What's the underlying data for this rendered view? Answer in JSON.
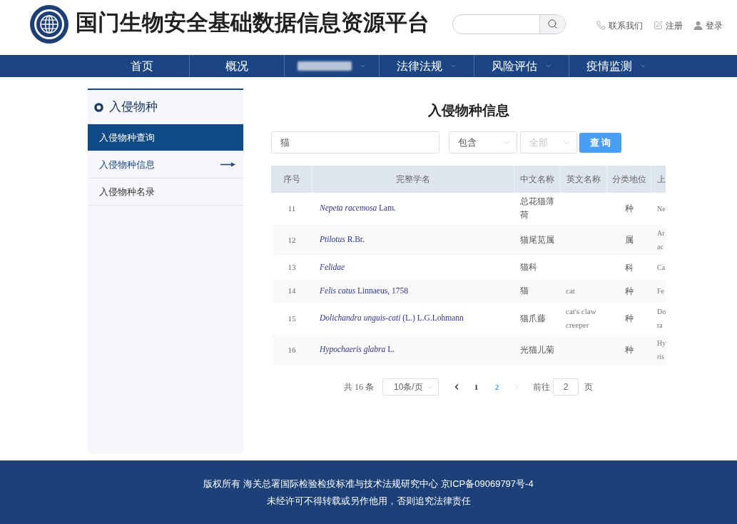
{
  "header": {
    "site_title": "国门生物安全基础数据信息资源平台",
    "links": [
      {
        "kind": "contact",
        "label": "联系我们"
      },
      {
        "kind": "register",
        "label": "注册"
      },
      {
        "kind": "login",
        "label": "登录"
      }
    ]
  },
  "nav": [
    {
      "label": "首页",
      "redacted": false,
      "has_dropdown": false
    },
    {
      "label": "概况",
      "redacted": false,
      "has_dropdown": false
    },
    {
      "redacted": true,
      "has_dropdown": true
    },
    {
      "label": "法律法规",
      "redacted": false,
      "has_dropdown": true
    },
    {
      "label": "风险评估",
      "redacted": false,
      "has_dropdown": true
    },
    {
      "label": "疫情监测",
      "redacted": false,
      "has_dropdown": true
    }
  ],
  "sidebar": {
    "heading": "入侵物种",
    "items": [
      {
        "label": "入侵物种查询",
        "selected": true,
        "current": false
      },
      {
        "label": "入侵物种信息",
        "selected": false,
        "current": true
      },
      {
        "label": "入侵物种名录",
        "selected": false,
        "current": false
      }
    ]
  },
  "content": {
    "title": "入侵物种信息",
    "search": {
      "value": "猫"
    },
    "filters": [
      {
        "value": "包含"
      },
      {
        "placeholder": "全部"
      }
    ],
    "search_button": "查 询",
    "table": {
      "columns": [
        "序号",
        "完整学名",
        "中文名称",
        "英文名称",
        "分类地位",
        "上"
      ],
      "rows": [
        {
          "index": "11",
          "scientific_name": "*Nepeta racemosa* Lam.",
          "name_italic": false,
          "chinese_name": "总花猫薄荷",
          "rank": "种",
          "column_6": [
            "Ne"
          ]
        },
        {
          "index": "12",
          "scientific_name": "*Ptilotus* R.Br.",
          "name_italic": false,
          "chinese_name": "猫尾苋属",
          "rank": "属",
          "column_6": [
            "Ar",
            "ac"
          ]
        },
        {
          "index": "13",
          "scientific_name": "Felidae",
          "name_italic": true,
          "chinese_name": "猫科",
          "rank": "科",
          "column_6": [
            "Ca"
          ]
        },
        {
          "index": "14",
          "scientific_name": "*Felis catus* Linnaeus, 1758",
          "name_italic": false,
          "chinese_name": "猫",
          "english_name": "cat",
          "rank": "种",
          "column_6": [
            "Fe"
          ]
        },
        {
          "index": "15",
          "scientific_name": "*Dolichandra unguis-cati* (L.) L.G.Lohmann",
          "name_italic": false,
          "chinese_name": "猫爪藤",
          "english_name": "cat's claw creeper",
          "rank": "种",
          "column_6": [
            "Do",
            "ra"
          ]
        },
        {
          "index": "16",
          "scientific_name": "*Hypochaeris glabra* L.",
          "name_italic": false,
          "chinese_name": "光猫儿菊",
          "rank": "种",
          "column_6": [
            "Hy",
            "ris"
          ]
        }
      ]
    },
    "pagination": {
      "total": "共 16 条",
      "page_size": "10条/页",
      "prev_disabled": false,
      "pages": [
        {
          "label": "1",
          "selected": false
        },
        {
          "label": "2",
          "selected": true
        }
      ],
      "next_disabled": true,
      "jump_label": "前往",
      "jump_value": "2",
      "jump_suffix": "页"
    }
  },
  "footer": {
    "lines": [
      "版权所有 海关总署国际检验检疫标准与技术法规研究中心 京ICP备09069797号-4",
      "未经许可不得转载或另作他用，否则追究法律责任"
    ]
  }
}
